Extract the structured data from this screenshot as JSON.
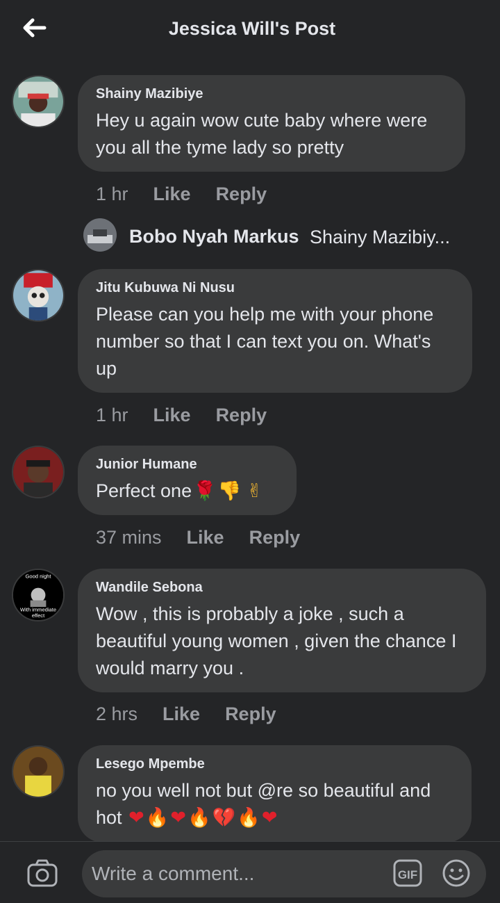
{
  "header": {
    "title": "Jessica Will's Post",
    "back_icon": "back-arrow-icon"
  },
  "comments": [
    {
      "author": "Shainy Mazibiye",
      "text": "Hey u again wow cute baby where were you all the tyme lady so pretty",
      "time": "1 hr",
      "like": "Like",
      "reply": "Reply"
    },
    {
      "author": "Jitu Kubuwa Ni Nusu",
      "text": "Please can you help me with your phone number so that I can text you on. What's up",
      "time": "1 hr",
      "like": "Like",
      "reply": "Reply"
    },
    {
      "author": "Junior Humane",
      "text": "Perfect one",
      "emojis": [
        "rose-emoji",
        "thumbs-down-emoji",
        "victory-hand-emoji"
      ],
      "time": "37 mins",
      "like": "Like",
      "reply": "Reply"
    },
    {
      "author": "Wandile Sebona",
      "text": "Wow , this is probably a joke , such a beautiful young women , given the chance I would marry you .",
      "time": "2 hrs",
      "like": "Like",
      "reply": "Reply",
      "avatar_text": [
        "Good night",
        "With immediate",
        "effect"
      ]
    },
    {
      "author": "Lesego Mpembe",
      "text": "no you well not but @re so beautiful and hot",
      "emojis": [
        "red-heart-emoji",
        "fire-emoji",
        "red-heart-emoji",
        "fire-emoji",
        "broken-heart-emoji",
        "fire-emoji",
        "red-heart-emoji"
      ]
    }
  ],
  "reply_preview": {
    "author": "Bobo Nyah Markus",
    "text": "Shainy Mazibiy..."
  },
  "composer": {
    "placeholder": "Write a comment...",
    "gif_label": "GIF"
  },
  "colors": {
    "background": "#242527",
    "bubble": "#3a3b3c",
    "text": "#e4e6eb",
    "meta": "#9a9ca1"
  }
}
